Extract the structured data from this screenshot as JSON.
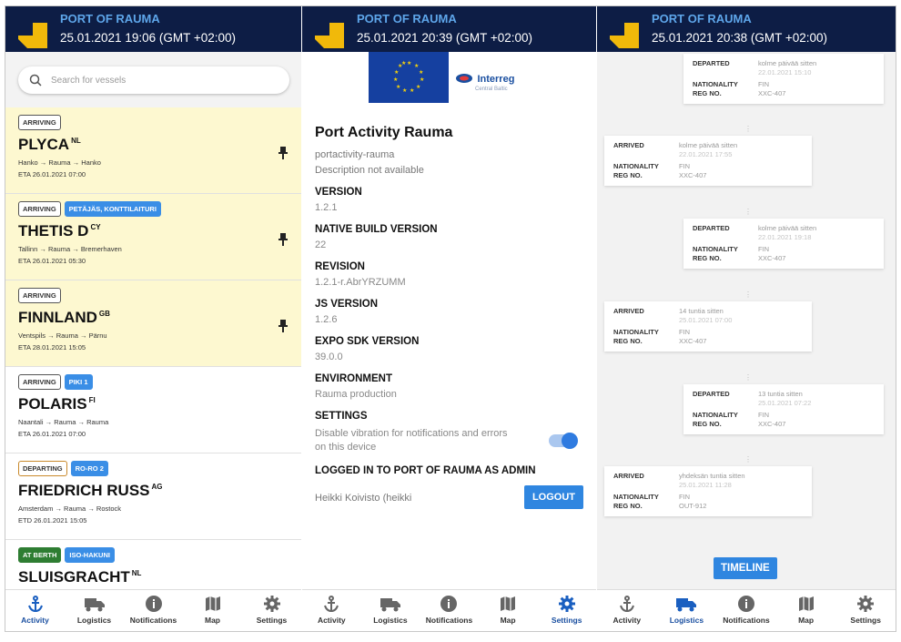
{
  "app": {
    "title": "PORT OF RAUMA"
  },
  "screens": [
    {
      "date": "25.01.2021 19:06 (GMT +02:00)"
    },
    {
      "date": "25.01.2021 20:39 (GMT +02:00)"
    },
    {
      "date": "25.01.2021 20:38 (GMT +02:00)"
    }
  ],
  "nav": [
    {
      "label": "Activity",
      "icon": "anchor-icon"
    },
    {
      "label": "Logistics",
      "icon": "truck-icon"
    },
    {
      "label": "Notifications",
      "icon": "info-icon"
    },
    {
      "label": "Map",
      "icon": "map-icon"
    },
    {
      "label": "Settings",
      "icon": "gear-icon"
    }
  ],
  "search": {
    "placeholder": "Search for vessels"
  },
  "vessels": [
    {
      "badges": [
        "ARRIVING"
      ],
      "name": "PLYCA",
      "flag": "NL",
      "route": [
        "Hanko",
        "Rauma",
        "Hanko"
      ],
      "eta": "ETA 26.01.2021 07:00",
      "pinned": true
    },
    {
      "badges": [
        "ARRIVING",
        "PETÄJÄS, KONTTILAITURI"
      ],
      "name": "THETIS D",
      "flag": "CY",
      "route": [
        "Tallinn",
        "Rauma",
        "Bremerhaven"
      ],
      "eta": "ETA 26.01.2021 05:30",
      "pinned": true
    },
    {
      "badges": [
        "ARRIVING"
      ],
      "name": "FINNLAND",
      "flag": "GB",
      "route": [
        "Ventspils",
        "Rauma",
        "Pärnu"
      ],
      "eta": "ETA 28.01.2021 15:05",
      "pinned": true
    },
    {
      "badges": [
        "ARRIVING",
        "PIKI 1"
      ],
      "name": "POLARIS",
      "flag": "FI",
      "route": [
        "Naantali",
        "Rauma",
        "Rauma"
      ],
      "eta": "ETA 26.01.2021 07:00",
      "pinned": false
    },
    {
      "badges": [
        "DEPARTING",
        "RO-RO 2"
      ],
      "name": "FRIEDRICH RUSS",
      "flag": "AG",
      "route": [
        "Amsterdam",
        "Rauma",
        "Rostock"
      ],
      "eta": "ETD 26.01.2021 15:05",
      "pinned": false
    },
    {
      "badges": [
        "AT BERTH",
        "ISO-HAKUNI"
      ],
      "name": "SLUISGRACHT",
      "flag": "NL",
      "route": [],
      "eta": "",
      "pinned": false
    }
  ],
  "about": {
    "logo_text": "Interreg",
    "logo_sub": "Central Baltic",
    "title": "Port Activity Rauma",
    "slug": "portactivity-rauma",
    "description": "Description not available",
    "version_label": "VERSION",
    "version": "1.2.1",
    "native_label": "NATIVE BUILD VERSION",
    "native": "22",
    "revision_label": "REVISION",
    "revision": "1.2.1-r.AbrYRZUMM",
    "js_label": "JS VERSION",
    "js": "1.2.6",
    "expo_label": "EXPO SDK VERSION",
    "expo": "39.0.0",
    "env_label": "ENVIRONMENT",
    "env": "Rauma production",
    "settings_label": "SETTINGS",
    "settings_text": "Disable vibration for notifications and errors on this device",
    "vibration_disabled": true,
    "logged_label": "LOGGED IN TO PORT OF RAUMA AS ADMIN",
    "user": "Heikki Koivisto (heikki",
    "logout": "LOGOUT"
  },
  "timeline": {
    "keys": {
      "departed": "DEPARTED",
      "arrived": "ARRIVED",
      "nationality": "NATIONALITY",
      "reg": "REG NO."
    },
    "events": [
      {
        "type": "departed",
        "rel": "kolme päivää sitten",
        "time": "22.01.2021 15:10",
        "nationality": "FIN",
        "reg": "XXC-407"
      },
      {
        "type": "arrived",
        "rel": "kolme päivää sitten",
        "time": "22.01.2021 17:55",
        "nationality": "FIN",
        "reg": "XXC-407"
      },
      {
        "type": "departed",
        "rel": "kolme päivää sitten",
        "time": "22.01.2021 19:18",
        "nationality": "FIN",
        "reg": "XXC-407"
      },
      {
        "type": "arrived",
        "rel": "14 tuntia sitten",
        "time": "25.01.2021 07:00",
        "nationality": "FIN",
        "reg": "XXC-407"
      },
      {
        "type": "departed",
        "rel": "13 tuntia sitten",
        "time": "25.01.2021 07:22",
        "nationality": "FIN",
        "reg": "XXC-407"
      },
      {
        "type": "arrived",
        "rel": "yhdeksän tuntia sitten",
        "time": "25.01.2021 11:28",
        "nationality": "FIN",
        "reg": "OUT-912"
      }
    ],
    "button": "TIMELINE"
  }
}
